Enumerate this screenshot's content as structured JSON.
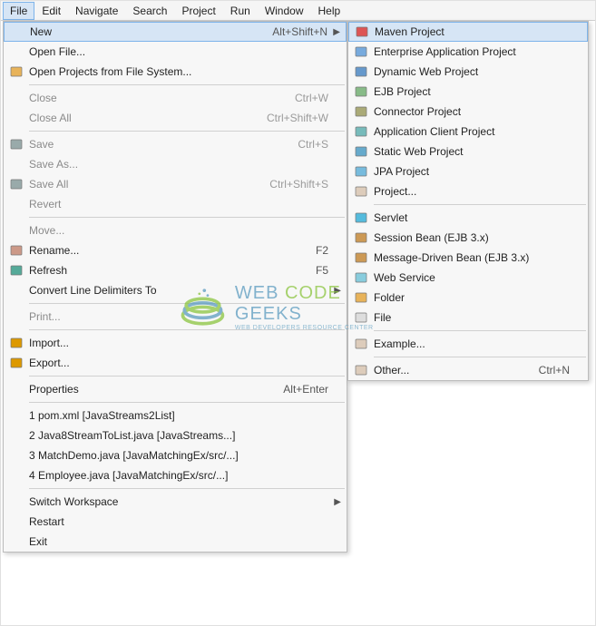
{
  "menubar": {
    "items": [
      "File",
      "Edit",
      "Navigate",
      "Search",
      "Project",
      "Run",
      "Window",
      "Help"
    ],
    "active": "File"
  },
  "fileMenu": {
    "groups": [
      [
        {
          "label": "New",
          "shortcut": "Alt+Shift+N",
          "icon": "",
          "arrow": true,
          "highlighted": true
        },
        {
          "label": "Open File...",
          "icon": ""
        },
        {
          "label": "Open Projects from File System...",
          "icon": "folder-open"
        }
      ],
      [
        {
          "label": "Close",
          "shortcut": "Ctrl+W",
          "disabled": true
        },
        {
          "label": "Close All",
          "shortcut": "Ctrl+Shift+W",
          "disabled": true
        }
      ],
      [
        {
          "label": "Save",
          "shortcut": "Ctrl+S",
          "icon": "save",
          "disabled": true
        },
        {
          "label": "Save As...",
          "disabled": true
        },
        {
          "label": "Save All",
          "shortcut": "Ctrl+Shift+S",
          "icon": "save-all",
          "disabled": true
        },
        {
          "label": "Revert",
          "disabled": true
        }
      ],
      [
        {
          "label": "Move...",
          "disabled": true
        },
        {
          "label": "Rename...",
          "shortcut": "F2",
          "icon": "rename"
        },
        {
          "label": "Refresh",
          "shortcut": "F5",
          "icon": "refresh"
        },
        {
          "label": "Convert Line Delimiters To",
          "arrow": true
        }
      ],
      [
        {
          "label": "Print...",
          "disabled": true
        }
      ],
      [
        {
          "label": "Import...",
          "icon": "import"
        },
        {
          "label": "Export...",
          "icon": "export"
        }
      ],
      [
        {
          "label": "Properties",
          "shortcut": "Alt+Enter"
        }
      ],
      [
        {
          "label": "1 pom.xml  [JavaStreams2List]"
        },
        {
          "label": "2 Java8StreamToList.java  [JavaStreams...]"
        },
        {
          "label": "3 MatchDemo.java  [JavaMatchingEx/src/...]"
        },
        {
          "label": "4 Employee.java  [JavaMatchingEx/src/...]"
        }
      ],
      [
        {
          "label": "Switch Workspace",
          "arrow": true
        },
        {
          "label": "Restart"
        },
        {
          "label": "Exit"
        }
      ]
    ]
  },
  "newSubmenu": {
    "groups": [
      [
        {
          "label": "Maven Project",
          "icon": "maven",
          "highlighted": true
        },
        {
          "label": "Enterprise Application Project",
          "icon": "ear"
        },
        {
          "label": "Dynamic Web Project",
          "icon": "web"
        },
        {
          "label": "EJB Project",
          "icon": "ejb"
        },
        {
          "label": "Connector Project",
          "icon": "connector"
        },
        {
          "label": "Application Client Project",
          "icon": "appclient"
        },
        {
          "label": "Static Web Project",
          "icon": "static-web"
        },
        {
          "label": "JPA Project",
          "icon": "jpa"
        },
        {
          "label": "Project...",
          "icon": "project"
        }
      ],
      [
        {
          "label": "Servlet",
          "icon": "servlet"
        },
        {
          "label": "Session Bean (EJB 3.x)",
          "icon": "bean"
        },
        {
          "label": "Message-Driven Bean (EJB 3.x)",
          "icon": "bean"
        },
        {
          "label": "Web Service",
          "icon": "ws"
        },
        {
          "label": "Folder",
          "icon": "folder"
        },
        {
          "label": "File",
          "icon": "file"
        }
      ],
      [
        {
          "label": "Example...",
          "icon": "example"
        }
      ],
      [
        {
          "label": "Other...",
          "shortcut": "Ctrl+N",
          "icon": "other"
        }
      ]
    ]
  },
  "watermark": {
    "title_pre": "WEB ",
    "title_mid": "CODE",
    "title_post": " GEEKS",
    "subtitle": "WEB DEVELOPERS RESOURCE CENTER"
  }
}
